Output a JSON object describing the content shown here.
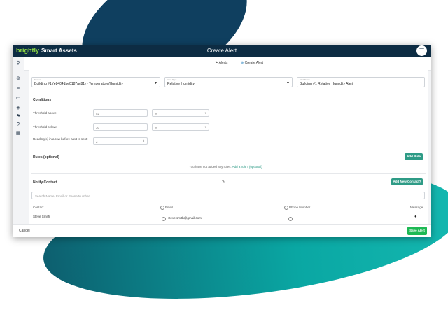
{
  "app": {
    "brand_prefix": "brightly",
    "brand_name": "Smart Assets",
    "window_title": "Create Alert",
    "menu_icon": "hamburger-icon"
  },
  "sidebar": {
    "icons": [
      "pin-icon",
      "plus-circle-icon",
      "list-icon",
      "chat-icon",
      "tag-icon",
      "filter-icon",
      "help-icon",
      "dashboard-icon"
    ]
  },
  "subnav": {
    "alerts_label": "Alerts",
    "create_label": "Create Alert"
  },
  "top_fields": {
    "sensor": {
      "label": "Sensor",
      "value": "Building #1 (e84041be0187ac81) - Temperature/Humidity"
    },
    "alert_type": {
      "label": "Alert Type",
      "value": "Relative Humidity"
    },
    "alert_name": {
      "label": "Alert Name",
      "value": "Building #1 Relative Humidity Alert"
    }
  },
  "conditions": {
    "heading": "Conditions",
    "threshold_above": {
      "label": "Threshold above:",
      "value": "52",
      "unit": "%"
    },
    "threshold_below": {
      "label": "Threshold below:",
      "value": "30",
      "unit": "%"
    },
    "readings": {
      "label": "Reading(s) in a row before alert is sent:",
      "value": "2"
    }
  },
  "rules": {
    "heading": "Rules (optional)",
    "add_button": "Add Rule",
    "empty_text": "You have not added any rules.",
    "empty_link": "Add a rule? (optional)"
  },
  "notify": {
    "heading": "Notify Contact",
    "add_button": "Add New Contact?",
    "search_placeholder": "Search Name, Email or Phone Number",
    "columns": {
      "contact": "Contact",
      "email": "Email",
      "phone": "Phone Number",
      "message": "Message"
    },
    "rows": [
      {
        "name": "Steve Smith",
        "email": "steve.smith@gmail.com"
      }
    ]
  },
  "footer": {
    "cancel": "Cancel",
    "save": "Save Alert"
  }
}
